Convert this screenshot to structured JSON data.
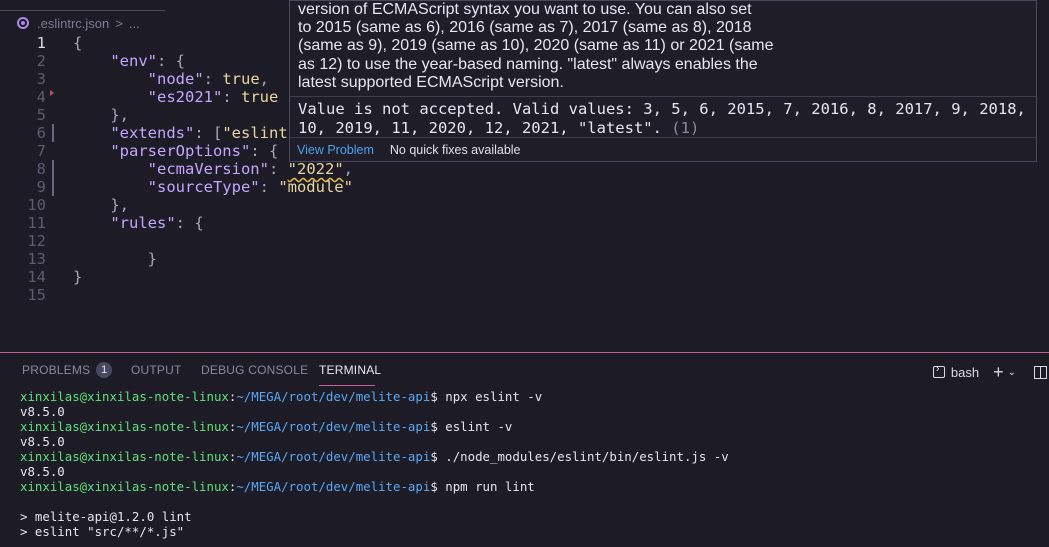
{
  "breadcrumb": {
    "file": ".eslintrc.json",
    "separator": ">",
    "ellipsis": "..."
  },
  "editor": {
    "lines": [
      {
        "num": "1",
        "tokens": [
          {
            "t": "punc",
            "v": "{"
          }
        ]
      },
      {
        "num": "2",
        "tokens": [
          {
            "t": "punc",
            "v": "    "
          },
          {
            "t": "key",
            "v": "\"env\""
          },
          {
            "t": "punc",
            "v": ": {"
          }
        ]
      },
      {
        "num": "3",
        "tokens": [
          {
            "t": "punc",
            "v": "        "
          },
          {
            "t": "key",
            "v": "\"node\""
          },
          {
            "t": "punc",
            "v": ": "
          },
          {
            "t": "lit",
            "v": "true"
          },
          {
            "t": "punc",
            "v": ","
          }
        ]
      },
      {
        "num": "4",
        "tokens": [
          {
            "t": "punc",
            "v": "        "
          },
          {
            "t": "key",
            "v": "\"es2021\""
          },
          {
            "t": "punc",
            "v": ": "
          },
          {
            "t": "lit",
            "v": "true"
          }
        ]
      },
      {
        "num": "5",
        "tokens": [
          {
            "t": "punc",
            "v": "    },"
          }
        ]
      },
      {
        "num": "6",
        "tokens": [
          {
            "t": "punc",
            "v": "    "
          },
          {
            "t": "key",
            "v": "\"extends\""
          },
          {
            "t": "punc",
            "v": ": ["
          },
          {
            "t": "str",
            "v": "\"eslint"
          }
        ]
      },
      {
        "num": "7",
        "tokens": [
          {
            "t": "punc",
            "v": "    "
          },
          {
            "t": "key",
            "v": "\"parserOptions\""
          },
          {
            "t": "punc",
            "v": ": {"
          }
        ]
      },
      {
        "num": "8",
        "tokens": [
          {
            "t": "punc",
            "v": "        "
          },
          {
            "t": "key",
            "v": "\"ecmaVersion\""
          },
          {
            "t": "punc",
            "v": ": "
          },
          {
            "t": "str err",
            "v": "\"2022\""
          },
          {
            "t": "punc",
            "v": ","
          }
        ]
      },
      {
        "num": "9",
        "tokens": [
          {
            "t": "punc",
            "v": "        "
          },
          {
            "t": "key",
            "v": "\"sourceType\""
          },
          {
            "t": "punc",
            "v": ": "
          },
          {
            "t": "str",
            "v": "\"module\""
          }
        ]
      },
      {
        "num": "10",
        "tokens": [
          {
            "t": "punc",
            "v": "    },"
          }
        ]
      },
      {
        "num": "11",
        "tokens": [
          {
            "t": "punc",
            "v": "    "
          },
          {
            "t": "key",
            "v": "\"rules\""
          },
          {
            "t": "punc",
            "v": ": {"
          }
        ]
      },
      {
        "num": "12",
        "tokens": []
      },
      {
        "num": "13",
        "tokens": [
          {
            "t": "punc",
            "v": "        }"
          }
        ]
      },
      {
        "num": "14",
        "tokens": [
          {
            "t": "punc",
            "v": "}"
          }
        ]
      },
      {
        "num": "15",
        "tokens": []
      }
    ],
    "current_line": "1"
  },
  "hover": {
    "description_lines": [
      "version of ECMAScript syntax you want to use. You can also set",
      "to 2015 (same as 6), 2016 (same as 7), 2017 (same as 8), 2018",
      "(same as 9), 2019 (same as 10), 2020 (same as 11) or 2021 (same",
      "as 12) to use the year-based naming. \"latest\" always enables the",
      "latest supported ECMAScript version."
    ],
    "problem_line1": "Value is not accepted. Valid values: 3, 5, 6, 2015, 7, 2016, 8, 2017, 9, 2018,",
    "problem_line2": "10, 2019, 11, 2020, 12, 2021, \"latest\".",
    "problem_code": "(1)",
    "view_problem": "View Problem",
    "no_fixes": "No quick fixes available"
  },
  "panel": {
    "tabs": [
      {
        "label": "PROBLEMS",
        "badge": "1"
      },
      {
        "label": "OUTPUT"
      },
      {
        "label": "DEBUG CONSOLE"
      },
      {
        "label": "TERMINAL",
        "active": true
      }
    ],
    "shell": "bash",
    "plus": "+",
    "chevron": "⌄"
  },
  "terminal": {
    "user": "xinxilas@xinxilas-note-linux",
    "path": "~/MEGA/root/dev/melite-api",
    "lines": [
      {
        "kind": "prompt",
        "cmd": " npx eslint -v"
      },
      {
        "kind": "out",
        "text": "v8.5.0"
      },
      {
        "kind": "prompt",
        "cmd": " eslint -v"
      },
      {
        "kind": "out",
        "text": "v8.5.0"
      },
      {
        "kind": "prompt",
        "cmd": " ./node_modules/eslint/bin/eslint.js -v"
      },
      {
        "kind": "out",
        "text": "v8.5.0"
      },
      {
        "kind": "prompt",
        "cmd": " npm run lint"
      },
      {
        "kind": "out",
        "text": ""
      },
      {
        "kind": "out",
        "text": "> melite-api@1.2.0 lint"
      },
      {
        "kind": "out",
        "text": "> eslint \"src/**/*.js\""
      }
    ]
  }
}
